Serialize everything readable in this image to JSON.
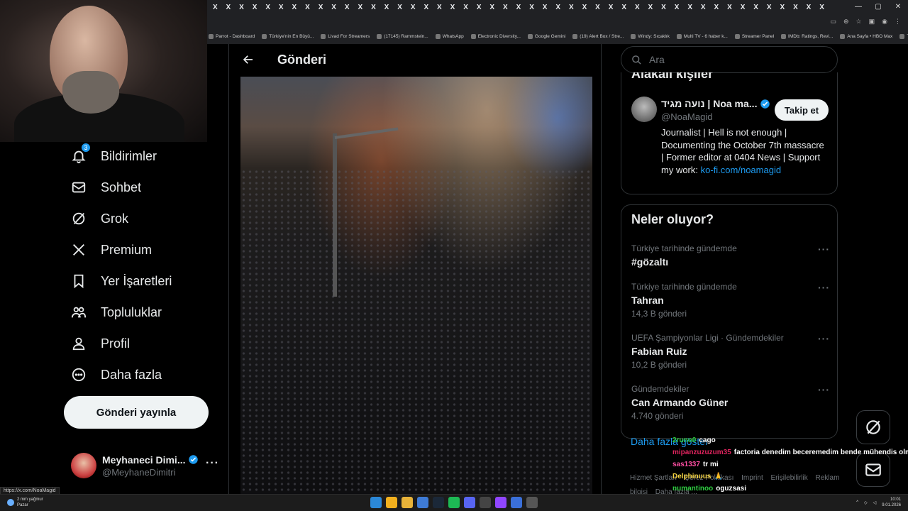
{
  "colors": {
    "accent": "#1d9bf0",
    "background": "#000000",
    "text": "#e7e9ea",
    "muted": "#71767b",
    "border": "#2f3336"
  },
  "browser": {
    "tab_count_label": "X",
    "bookmarks": [
      "Parrot - Dashboard",
      "Türkiye'nin En Büyü...",
      "Livad For Streamers",
      "(17145) Rammstein...",
      "WhatsApp",
      "Electronic Diversity...",
      "Google Gemini",
      "(19) Alert Box / Stre...",
      "Windy: Sıcaklık",
      "Multi TV - 6 haber k...",
      "Streamer Panel",
      "IMDb: Ratings, Revi...",
      "Ana Sayfa • HBO Max",
      "Tüm Yer İşaretleri"
    ]
  },
  "sidebar": {
    "items": [
      {
        "label": "Bildirimler",
        "icon": "bell-icon",
        "badge": "3"
      },
      {
        "label": "Sohbet",
        "icon": "envelope-icon"
      },
      {
        "label": "Grok",
        "icon": "grok-icon"
      },
      {
        "label": "Premium",
        "icon": "x-logo-icon"
      },
      {
        "label": "Yer İşaretleri",
        "icon": "bookmark-icon"
      },
      {
        "label": "Topluluklar",
        "icon": "people-icon"
      },
      {
        "label": "Profil",
        "icon": "person-icon"
      },
      {
        "label": "Daha fazla",
        "icon": "more-circle-icon"
      }
    ],
    "post_button": "Gönderi yayınla",
    "account": {
      "name": "Meyhaneci Dimi...",
      "handle": "@MeyhaneDimitri",
      "more": "···"
    }
  },
  "main": {
    "title": "Gönderi"
  },
  "right": {
    "search_placeholder": "Ara",
    "who_to_follow": {
      "heading": "Alakalı kişiler",
      "name": "נועה מגיד | Noa ma...",
      "handle": "@NoaMagid",
      "follow_label": "Takip et",
      "bio": "Journalist | Hell is not enough | Documenting the October 7th massacre | Former editor at 0404 News | Support my work: ",
      "bio_link": "ko-fi.com/noamagid"
    },
    "trends": {
      "heading": "Neler oluyor?",
      "items": [
        {
          "context": "Türkiye tarihinde gündemde",
          "name": "#gözaltı",
          "count": ""
        },
        {
          "context": "Türkiye tarihinde gündemde",
          "name": "Tahran",
          "count": "14,3 B gönderi"
        },
        {
          "context": "UEFA Şampiyonlar Ligi · Gündemdekiler",
          "name": "Fabian Ruiz",
          "count": "10,2 B gönderi"
        },
        {
          "context": "Gündemdekiler",
          "name": "Can Armando Güner",
          "count": "4.740 gönderi"
        }
      ],
      "more_label": "···",
      "show_more": "Daha fazla göster"
    },
    "footer": [
      "Hizmet Şartları",
      "Çerez Politikası",
      "Imprint",
      "Erişilebilirlik",
      "Reklam bilgisi",
      "Daha fazla ..."
    ]
  },
  "chat": [
    {
      "user": "2runo0",
      "message": "cago",
      "color": "#2ecc40"
    },
    {
      "user": "mipanzuzuzum35",
      "message": "factoria denedim beceremedim bende mühendis olmaz",
      "color": "#e0245e"
    },
    {
      "user": "sas1337",
      "message": "tr mi",
      "color": "#ff4fa3"
    },
    {
      "user": "Delphinuus",
      "message": "🙏",
      "color": "#f5d442"
    },
    {
      "user": "numantinoo",
      "message": "oguzsasi",
      "color": "#2ecc40"
    }
  ],
  "status_url": "https://x.com/NoaMagid",
  "taskbar": {
    "weather_temp": "2 mm yağmur",
    "weather_day": "Pazar",
    "time": "10:01",
    "date": "9.01.2026"
  }
}
